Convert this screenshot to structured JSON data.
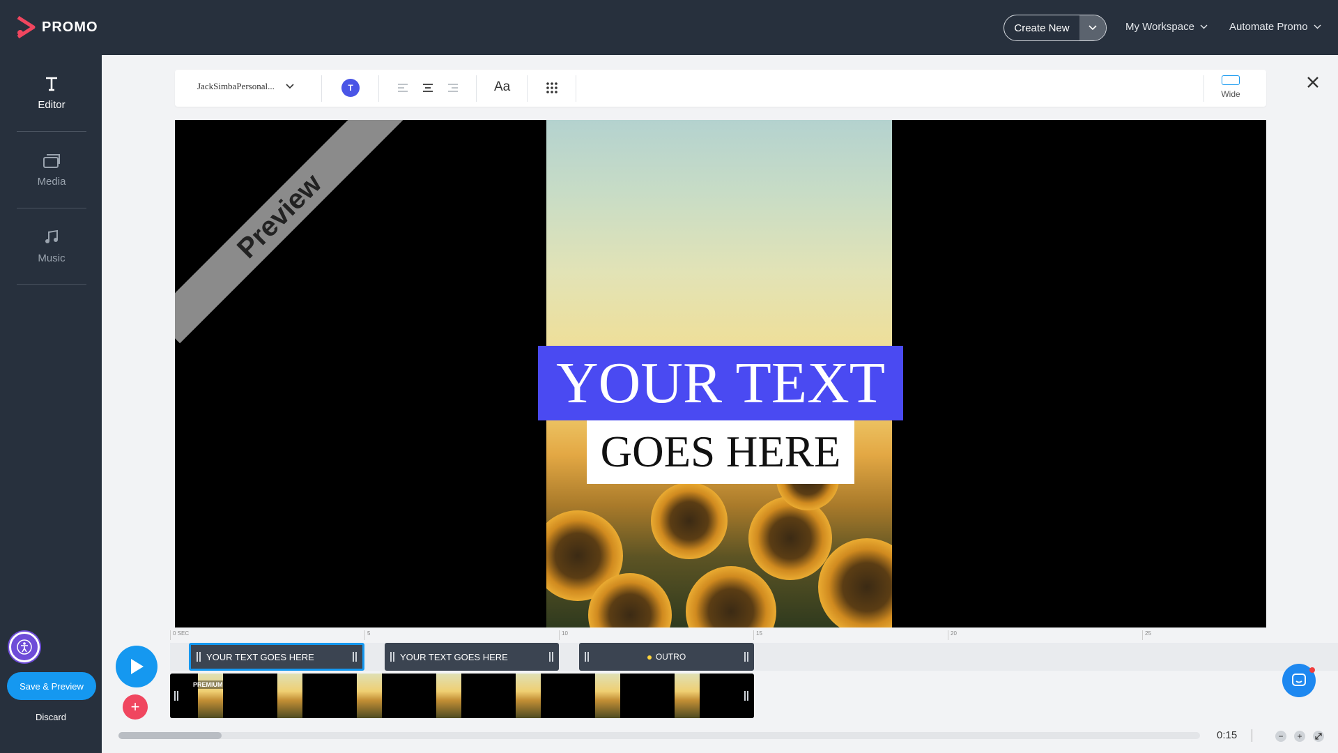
{
  "brand": {
    "name": "PROMO"
  },
  "header": {
    "create_new": "Create New",
    "workspace": "My Workspace",
    "automate": "Automate Promo"
  },
  "sidebar": {
    "items": [
      {
        "label": "Editor",
        "icon": "text-icon",
        "active": true
      },
      {
        "label": "Media",
        "icon": "media-icon",
        "active": false
      },
      {
        "label": "Music",
        "icon": "music-note-icon",
        "active": false
      }
    ],
    "save_preview": "Save & Preview",
    "discard": "Discard"
  },
  "toolbar": {
    "font": "JackSimbaPersonal...",
    "color_badge": "T",
    "text_size": "Aa",
    "aspect_label": "Wide"
  },
  "preview": {
    "watermark": "Preview",
    "headline": "YOUR TEXT",
    "subline": "GOES HERE"
  },
  "timeline": {
    "ticks": [
      "0 SEC",
      "5",
      "10",
      "15",
      "20",
      "25"
    ],
    "clips": [
      {
        "label": "YOUR TEXT GOES HERE",
        "selected": true
      },
      {
        "label": "YOUR TEXT GOES HERE",
        "selected": false
      },
      {
        "label": "OUTRO",
        "selected": false
      }
    ],
    "premium_badge": "PREMIUM",
    "duration": "0:15",
    "zoom_out": "−",
    "zoom_in": "+"
  },
  "colors": {
    "accent": "#1598f0",
    "headline_bg": "#4a4af2",
    "topbar": "#27303d",
    "add_button": "#f0465f"
  }
}
